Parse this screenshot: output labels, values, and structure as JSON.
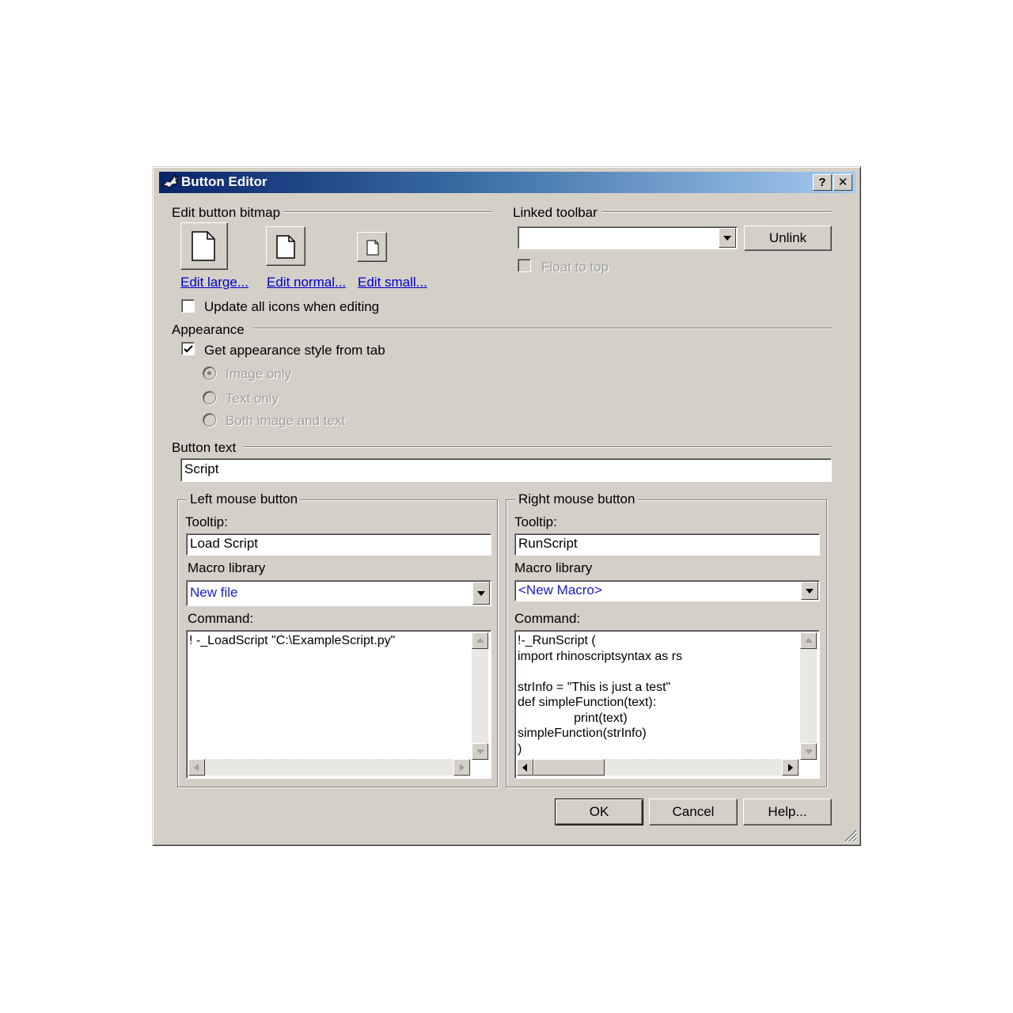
{
  "window": {
    "title": "Button Editor",
    "help_label": "?",
    "close_label": "✕"
  },
  "bitmap": {
    "section_label": "Edit button bitmap",
    "edit_large": "Edit large...",
    "edit_normal": "Edit normal...",
    "edit_small": "Edit small...",
    "update_all_label": "Update all icons when editing",
    "update_all_checked": false
  },
  "linked_toolbar": {
    "section_label": "Linked toolbar",
    "value": "",
    "unlink_label": "Unlink",
    "float_to_top_label": "Float to top",
    "float_to_top_checked": false
  },
  "appearance": {
    "section_label": "Appearance",
    "get_style_label": "Get appearance style from tab",
    "get_style_checked": true,
    "options": [
      "Image only",
      "Text only",
      "Both image and text"
    ],
    "selected": "Image only"
  },
  "button_text": {
    "section_label": "Button text",
    "value": "Script"
  },
  "left_mouse": {
    "group_label": "Left mouse button",
    "tooltip_label": "Tooltip:",
    "tooltip_value": "Load Script",
    "macro_label": "Macro library",
    "macro_value": "New file",
    "command_label": "Command:",
    "command_value": "! -_LoadScript \"C:\\ExampleScript.py\""
  },
  "right_mouse": {
    "group_label": "Right mouse button",
    "tooltip_label": "Tooltip:",
    "tooltip_value": "RunScript",
    "macro_label": "Macro library",
    "macro_value": "<New Macro>",
    "command_label": "Command:",
    "command_value": "!-_RunScript (\nimport rhinoscriptsyntax as rs\n\nstrInfo = \"This is just a test\"\ndef simpleFunction(text):\n                print(text)\nsimpleFunction(strInfo)\n)"
  },
  "footer": {
    "ok_label": "OK",
    "cancel_label": "Cancel",
    "help_label": "Help..."
  },
  "icons": {
    "app": "rhino-icon",
    "bitmap": "blank-page-icon",
    "resize": "resize-grip-icon"
  },
  "colors": {
    "dialog_bg": "#d4d0c8",
    "title_start": "#0a246a",
    "title_end": "#a6caf0",
    "link": "#0000cc",
    "combo_text": "#1a1ad0"
  }
}
